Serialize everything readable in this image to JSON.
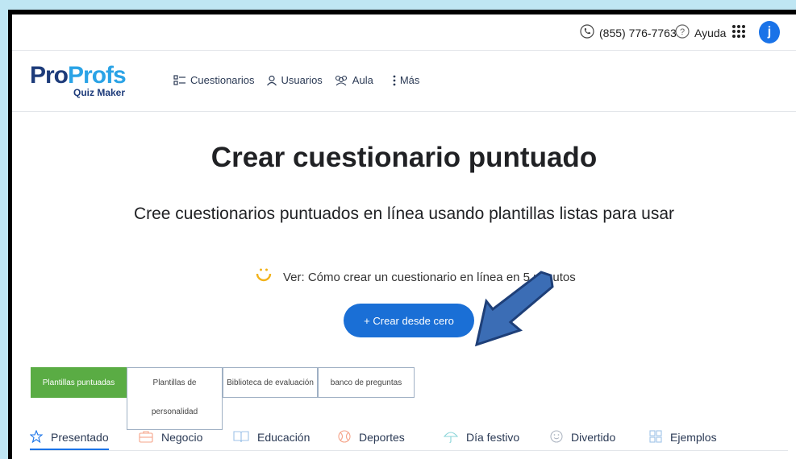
{
  "topbar": {
    "phone": "(855) 776-7763",
    "help_label": "Ayuda",
    "avatar_initial": "j"
  },
  "logo": {
    "brand_pro": "Pro",
    "brand_profs": "Profs",
    "product": "Quiz Maker"
  },
  "nav": {
    "items": [
      {
        "label": "Cuestionarios",
        "icon": "quiz-list-icon"
      },
      {
        "label": "Usuarios",
        "icon": "user-icon"
      },
      {
        "label": "Aula",
        "icon": "group-icon"
      },
      {
        "label": "Más",
        "icon": "more-vertical-icon"
      }
    ]
  },
  "hero": {
    "title": "Crear cuestionario puntuado",
    "subtitle": "Cree cuestionarios puntuados en línea usando plantillas listas para usar",
    "video_link": "Ver: Cómo crear un cuestionario en línea en 5 minutos",
    "create_button": "+ Crear desde cero"
  },
  "template_tabs": [
    {
      "label": "Plantillas puntuadas",
      "active": true
    },
    {
      "label_line1": "Plantillas de",
      "label_line2": "personalidad",
      "active": false
    },
    {
      "label": "Biblioteca de evaluación",
      "active": false
    },
    {
      "label": "banco de preguntas",
      "active": false
    }
  ],
  "categories": [
    {
      "label": "Presentado",
      "icon": "star-icon",
      "active": true
    },
    {
      "label": "Negocio",
      "icon": "briefcase-icon",
      "active": false
    },
    {
      "label": "Educación",
      "icon": "book-icon",
      "active": false
    },
    {
      "label": "Deportes",
      "icon": "ball-icon",
      "active": false
    },
    {
      "label": "Día festivo",
      "icon": "umbrella-icon",
      "active": false
    },
    {
      "label": "Divertido",
      "icon": "smile-icon",
      "active": false
    },
    {
      "label": "Ejemplos",
      "icon": "grid-icon",
      "active": false
    }
  ],
  "colors": {
    "accent_blue": "#1a6fd6",
    "active_tab_green": "#5aac44",
    "outer_background": "#bfe6f3",
    "annotation_arrow": "#3b6db5"
  }
}
